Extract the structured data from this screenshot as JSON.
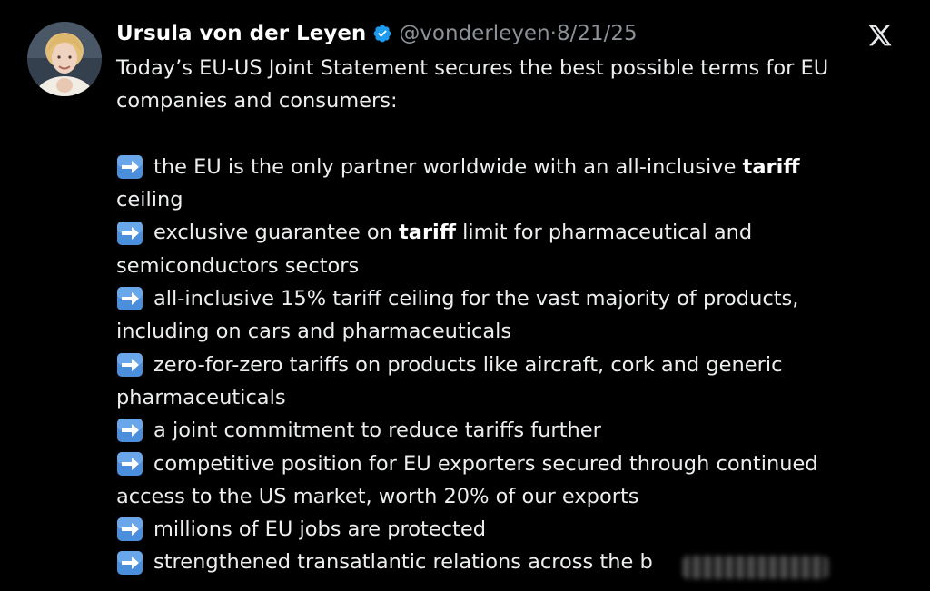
{
  "post": {
    "author_name": "Ursula von der Leyen",
    "handle": "@vonderleyen",
    "separator": "·",
    "date": "8/21/25",
    "intro_line_1": "Today’s EU-US Joint Statement secures the best possible terms for EU",
    "intro_line_2": "companies and consumers:",
    "items": [
      {
        "line1_before": "the EU is the only partner worldwide with an all-inclusive ",
        "line1_bold": "tariff",
        "line1_after": "",
        "line2": "ceiling"
      },
      {
        "line1_before": "exclusive guarantee on ",
        "line1_bold": "tariff",
        "line1_after": " limit for pharmaceutical and",
        "line2": "semiconductors sectors"
      },
      {
        "line1": "all-inclusive 15% tariff ceiling for the vast majority of products,",
        "line2": "including on cars and pharmaceuticals"
      },
      {
        "line1": "zero-for-zero tariffs on products like aircraft, cork and generic",
        "line2": "pharmaceuticals"
      },
      {
        "line1": "a joint commitment to reduce tariffs further"
      },
      {
        "line1": "competitive position for EU exporters secured through continued",
        "line2": "access to the US market, worth 20% of our exports"
      },
      {
        "line1": "millions of EU jobs are protected"
      },
      {
        "line1": "strengthened transatlantic relations across the b"
      }
    ]
  },
  "icons": {
    "platform": "x-logo-icon",
    "verified": "verified-badge-icon",
    "bullet": "right-arrow-emoji-icon"
  },
  "colors": {
    "background": "#000000",
    "text": "#e7e9ea",
    "muted": "#8b9196",
    "verified": "#1d9bf0",
    "arrow_box": "#4b8fdc"
  }
}
